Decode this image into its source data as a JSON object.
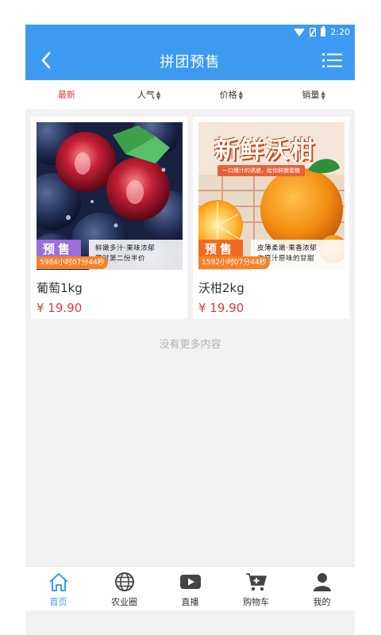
{
  "status_bar": {
    "time": "2:20"
  },
  "header": {
    "title": "拼团预售"
  },
  "sort_tabs": [
    {
      "label": "最新",
      "active": true,
      "arrows": ""
    },
    {
      "label": "人气",
      "active": false,
      "arrows": "▲▼"
    },
    {
      "label": "价格",
      "active": false,
      "arrows": "▲▼"
    },
    {
      "label": "销量",
      "active": false,
      "arrows": "▲▼"
    }
  ],
  "products": [
    {
      "name": "葡萄1kg",
      "price": "¥ 19.90",
      "timer": "5984小时07分44秒",
      "badge": "预售",
      "slogan_line1": "鲜嫩多汁·果味浓郁",
      "slogan_line2": "限时第二份半价"
    },
    {
      "name": "沃柑2kg",
      "price": "¥ 19.90",
      "timer": "1592小时07分44秒",
      "badge": "预售",
      "slogan_line1": "皮薄柔嫩·果香浓郁",
      "slogan_line2": "你原汁原味的甘甜",
      "promo_title": "新鲜沃柑",
      "promo_sub": "一口爆汁的诱惑，给你鲜嫩蜜糖"
    }
  ],
  "no_more_text": "没有更多内容",
  "bottom_nav": [
    {
      "label": "首页",
      "icon": "home-icon",
      "active": true
    },
    {
      "label": "农业圈",
      "icon": "globe-icon",
      "active": false
    },
    {
      "label": "直播",
      "icon": "play-icon",
      "active": false
    },
    {
      "label": "购物车",
      "icon": "cart-icon",
      "active": false
    },
    {
      "label": "我的",
      "icon": "person-icon",
      "active": false
    }
  ],
  "colors": {
    "primary": "#3c9bf1",
    "price": "#e23a3a",
    "timer": "#f6822a",
    "grape_badge": "#9b6fd8",
    "orange_badge": "#f26a21"
  }
}
